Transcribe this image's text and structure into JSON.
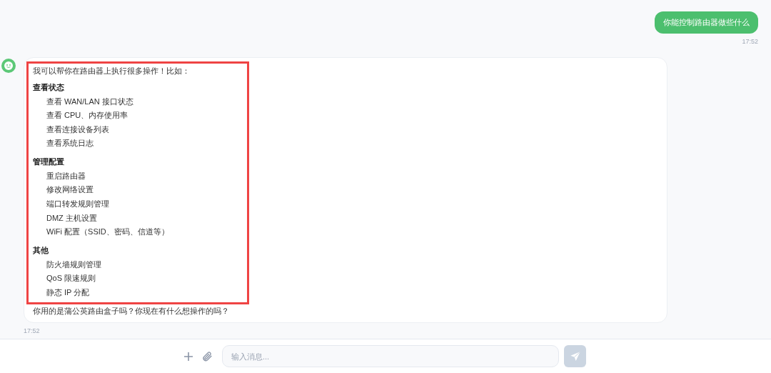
{
  "messages": [
    {
      "kind": "sent",
      "text": "你能控制路由器做些什么",
      "time": "17:52"
    },
    {
      "kind": "received",
      "highlighted": true,
      "intro": "我可以帮你在路由器上执行很多操作！比如：",
      "sections": [
        {
          "heading": "查看状态",
          "items": [
            "查看 WAN/LAN 接口状态",
            "查看 CPU、内存使用率",
            "查看连接设备列表",
            "查看系统日志"
          ]
        },
        {
          "heading": "管理配置",
          "items": [
            "重启路由器",
            "修改网络设置",
            "端口转发规则管理",
            "DMZ 主机设置",
            "WiFi 配置（SSID、密码、信道等）"
          ]
        },
        {
          "heading": "其他",
          "items": [
            "防火墙规则管理",
            "QoS 限速规则",
            "静态 IP 分配"
          ]
        }
      ],
      "outro": "你用的是蒲公英路由盒子吗？你现在有什么想操作的吗？",
      "time": "17:52"
    }
  ],
  "composer": {
    "placeholder": "输入消息..."
  }
}
